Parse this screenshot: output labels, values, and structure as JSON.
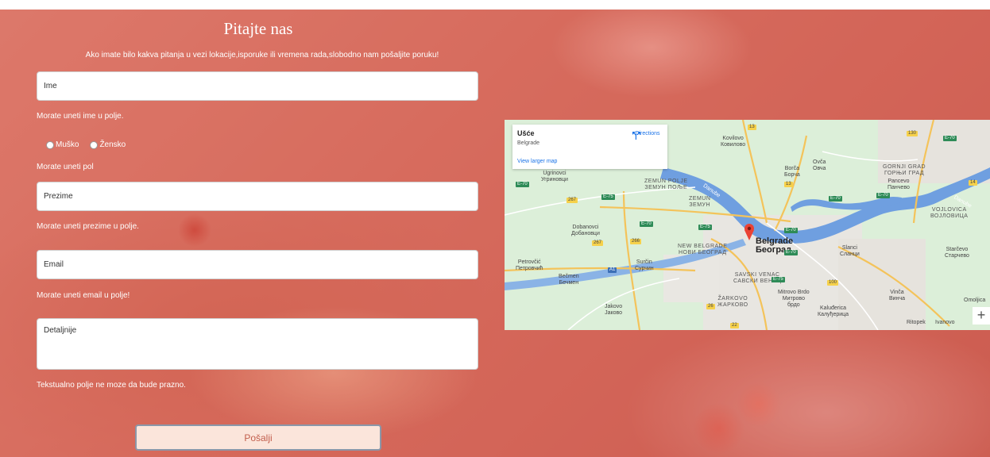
{
  "form": {
    "title": "Pitajte nas",
    "subtitle": "Ako imate bilo kakva pitanja u vezi lokacije,isporuke ili vremena rada,slobodno nam pošaljite poruku!",
    "name_placeholder": "Ime",
    "name_error": "Morate uneti ime u polje.",
    "gender_options": [
      "Muško",
      "Žensko"
    ],
    "gender_error": "Morate uneti pol",
    "surname_placeholder": "Prezime",
    "surname_error": "Morate uneti prezime u polje.",
    "email_placeholder": "Email",
    "email_error": "Morate uneti email u polje!",
    "details_placeholder": "Detaljnije",
    "details_error": "Tekstualno polje ne moze da bude prazno.",
    "submit_label": "Pošalji"
  },
  "map": {
    "place_name": "Ušće",
    "place_region": "Belgrade",
    "directions_label": "Directions",
    "larger_map_label": "View larger map",
    "zoom_in_label": "+",
    "labels": {
      "kovilovo": "Kovilovo",
      "kovilovo_cyr": "Ковилово",
      "borca": "Borča",
      "borca_cyr": "Борча",
      "ovca": "Ovča",
      "ovca_cyr": "Овча",
      "gornji_grad": "GORNJI GRAD",
      "gornji_grad_cyr": "ГОРЊИ ГРАД",
      "pancevo": "Pancevo",
      "pancevo_cyr": "Панчево",
      "vojlovica": "VOJLOVICA",
      "vojlovica_cyr": "ВОЈЛОВИЦА",
      "ugrinovci": "Ugrinovci",
      "ugrinovci_cyr": "Угриновци",
      "zemun_polje": "ZEMUN POLJE",
      "zemun_polje_cyr": "ЗЕМУН ПОЉЕ",
      "zemun": "ZEMUN",
      "zemun_cyr": "ЗЕМУН",
      "dobanovci": "Dobanovci",
      "dobanovci_cyr": "Добановци",
      "new_belgrade": "NEW BELGRADE",
      "new_belgrade_cyr": "НОВИ БЕОГРАД",
      "belgrade": "Belgrade",
      "belgrade_cyr": "Београд",
      "slanci": "Slanci",
      "slanci_cyr": "Сланци",
      "starcevo": "Starčevo",
      "starcevo_cyr": "Старчево",
      "petrovcic": "Petrovčić",
      "petrovcic_cyr": "Петровчић",
      "surcin": "Surčin",
      "surcin_cyr": "Сурчин",
      "becmen": "Bečmen",
      "becmen_cyr": "Бечмен",
      "savski_venac": "SAVSKI VENAC",
      "savski_venac_cyr": "САВСКИ ВЕНАЦ",
      "mitrovo_brdo": "Mitrovo Brdo",
      "mitrovo_brdo_cyr": "Митрово",
      "mitrovo_brdo_cyr2": "брдо",
      "vinca": "Vinča",
      "vinca_cyr": "Винча",
      "omoljica": "Omoljica",
      "zarkovo": "ŽARKOVO",
      "zarkovo_cyr": "ЖАРКОВО",
      "kaludjerica": "Kaluđerica",
      "kaludjerica_cyr": "Калуђерица",
      "jakovo": "Jakovo",
      "jakovo_cyr": "Јаково",
      "ritopek": "Ritopek",
      "ivanovo": "Ivanovo",
      "danube": "Danube",
      "danube_2": "Danube"
    },
    "shields": [
      "13",
      "130",
      "E-70",
      "267",
      "E-75",
      "E-70",
      "13",
      "E-70",
      "E-70",
      "14",
      "E-75",
      "E-70",
      "267",
      "266",
      "A1",
      "E-70",
      "E-75",
      "100",
      "26",
      "22",
      "E-70"
    ]
  },
  "colors": {
    "overlay": "#e66e64",
    "submit_text": "#c25e4d",
    "link_blue": "#1a73e8",
    "river": "#5b8fd6",
    "land": "#d9ecd8"
  }
}
